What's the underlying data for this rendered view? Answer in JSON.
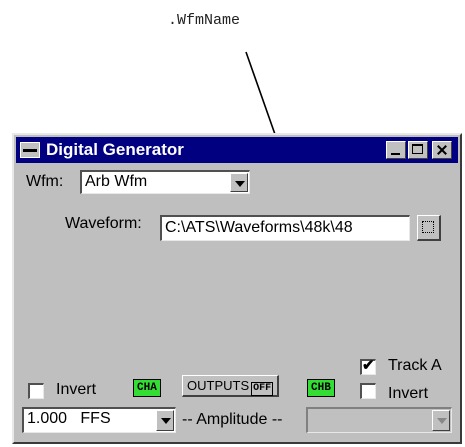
{
  "callout": {
    "label": ".WfmName"
  },
  "window": {
    "title": "Digital Generator"
  },
  "wfm": {
    "label": "Wfm:",
    "selected": "Arb Wfm"
  },
  "waveform": {
    "label": "Waveform:",
    "value": "C:\\ATS\\Waveforms\\48k\\48"
  },
  "channel_a": {
    "invert_label": "Invert",
    "invert_checked": false,
    "badge": "CHA"
  },
  "outputs": {
    "label": "OUTPUTS",
    "state": "OFF"
  },
  "channel_b": {
    "badge": "CHB",
    "invert_label": "Invert",
    "invert_checked": false,
    "track_label": "Track A",
    "track_checked": true
  },
  "amplitude": {
    "value": "1.000",
    "unit": "FFS",
    "label": "-- Amplitude --"
  },
  "colors": {
    "titlebar": "#000080",
    "window_bg": "#bfbfbf",
    "badge_green": "#33dd33"
  },
  "icons": [
    "system-menu-icon",
    "minimize-icon",
    "maximize-icon",
    "close-icon",
    "dropdown-arrow-icon",
    "browse-icon",
    "checkmark-icon"
  ]
}
